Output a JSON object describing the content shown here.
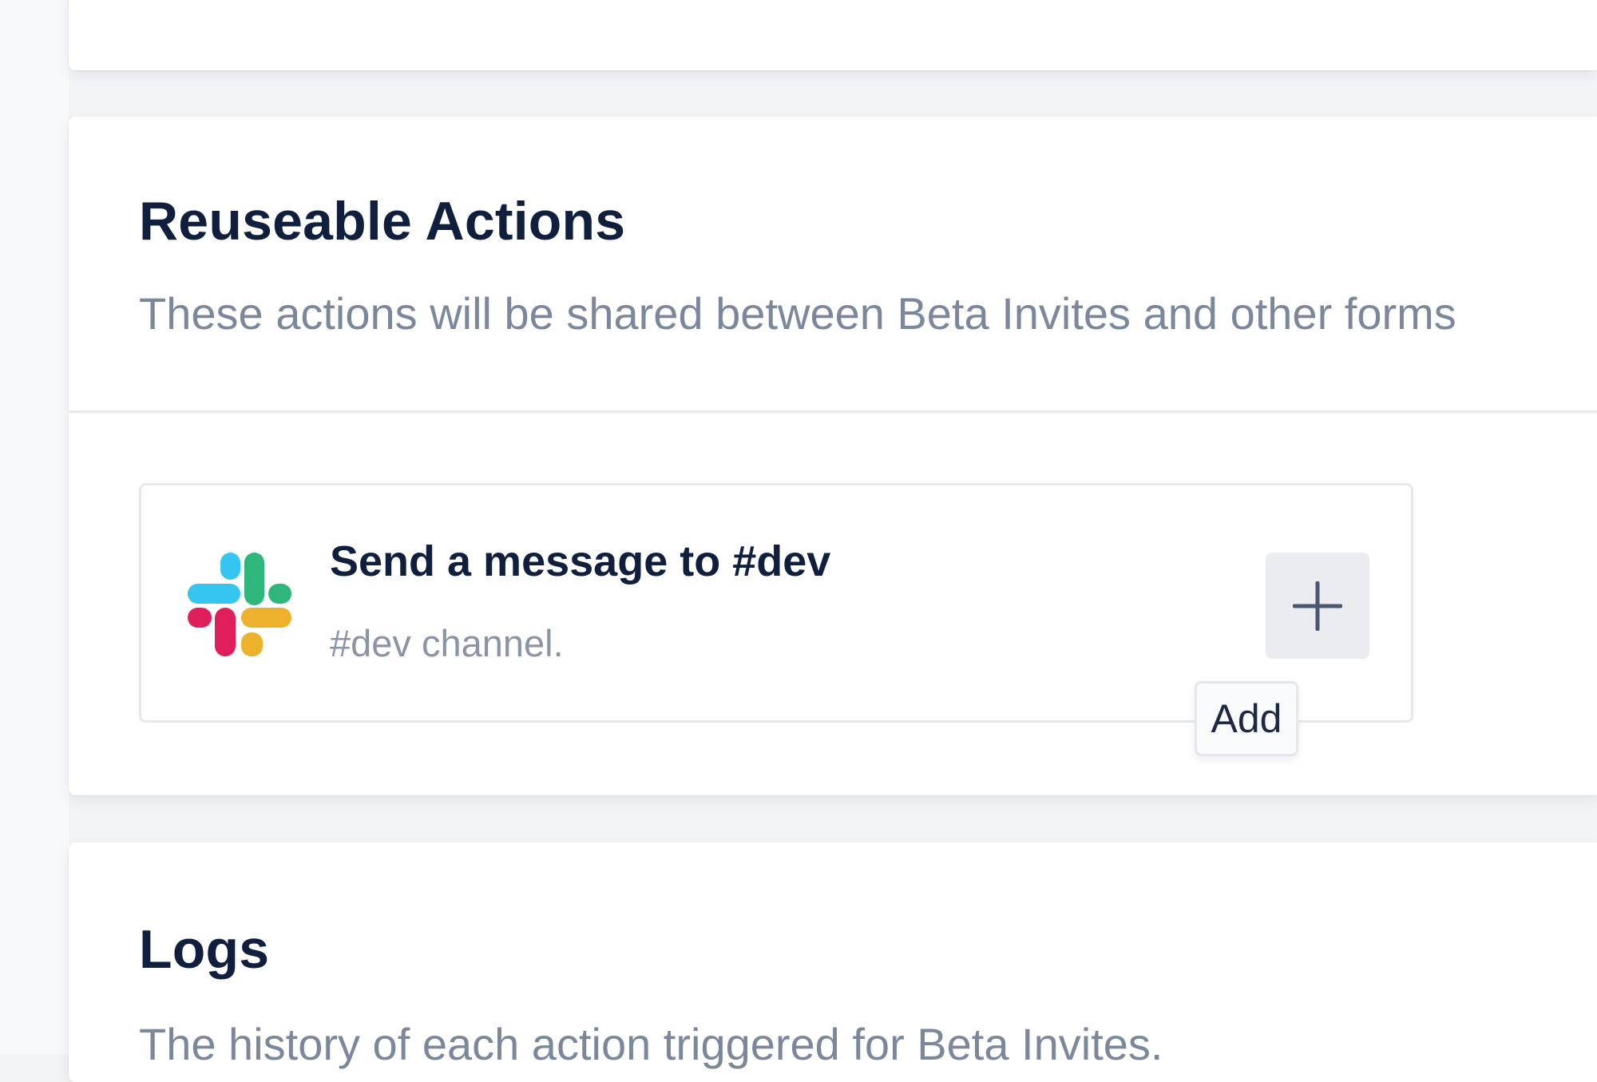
{
  "reusable_actions": {
    "title": "Reuseable Actions",
    "description": "These actions will be shared between Beta Invites and other forms",
    "items": [
      {
        "title": "Send a message to #dev",
        "subtitle": "#dev channel.",
        "icon": "slack-logo-icon"
      }
    ],
    "add_button_icon": "plus-icon",
    "add_tooltip": "Add"
  },
  "logs": {
    "title": "Logs",
    "description": "The history of each action triggered for Beta Invites."
  },
  "colors": {
    "heading": "#0f1f3d",
    "muted": "#7b879b",
    "slack_blue": "#36c5f0",
    "slack_green": "#2eb67d",
    "slack_red": "#e01e5a",
    "slack_yellow": "#ecb22e"
  }
}
